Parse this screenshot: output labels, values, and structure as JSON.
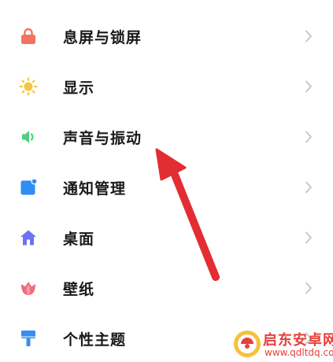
{
  "settings": {
    "items": [
      {
        "label": "息屏与锁屏",
        "icon": "lock-icon",
        "color": "#f4735f"
      },
      {
        "label": "显示",
        "icon": "sun-icon",
        "color": "#f6c542"
      },
      {
        "label": "声音与振动",
        "icon": "speaker-icon",
        "color": "#4cd07d"
      },
      {
        "label": "通知管理",
        "icon": "notification-icon",
        "color": "#2f8ef2"
      },
      {
        "label": "桌面",
        "icon": "home-icon",
        "color": "#6a74f0"
      },
      {
        "label": "壁纸",
        "icon": "tulip-icon",
        "color": "#f06b7e"
      },
      {
        "label": "个性主题",
        "icon": "brush-icon",
        "color": "#3b8cf0"
      }
    ],
    "chevron_color": "#c4c4c4"
  },
  "annotation": {
    "arrow_color": "#e22d33"
  },
  "watermark": {
    "title": "启东安卓网",
    "url": "www.qdltdq.com",
    "color": "#e5403a"
  }
}
